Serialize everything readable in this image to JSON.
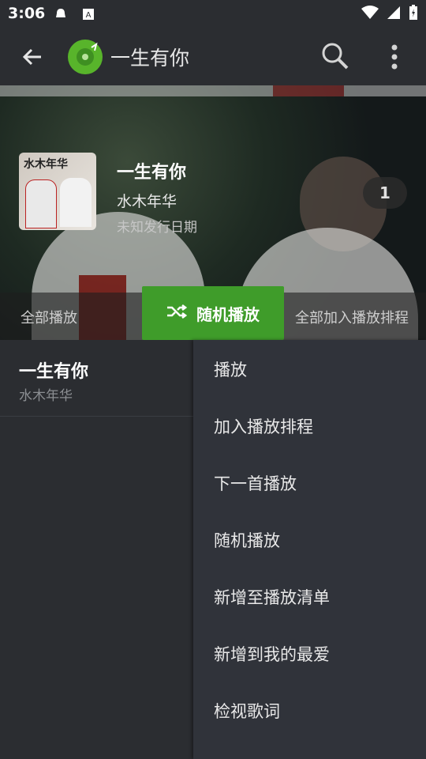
{
  "status": {
    "time": "3:06"
  },
  "header": {
    "title": "一生有你"
  },
  "hero": {
    "song_title": "一生有你",
    "artist": "水木年华",
    "release_date": "未知发行日期",
    "count_badge": "1",
    "album_cover_text": "水木年华"
  },
  "actions": {
    "play_all": "全部播放",
    "shuffle": "随机播放",
    "add_all_to_queue": "全部加入播放排程"
  },
  "list": {
    "items": [
      {
        "title": "一生有你",
        "subtitle": "水木年华"
      }
    ]
  },
  "menu": {
    "items": [
      "播放",
      "加入播放排程",
      "下一首播放",
      "随机播放",
      "新增至播放清单",
      "新增到我的最爱",
      "检视歌词"
    ]
  },
  "colors": {
    "accent_green": "#3f9c2a",
    "logo_green": "#58b42b"
  }
}
